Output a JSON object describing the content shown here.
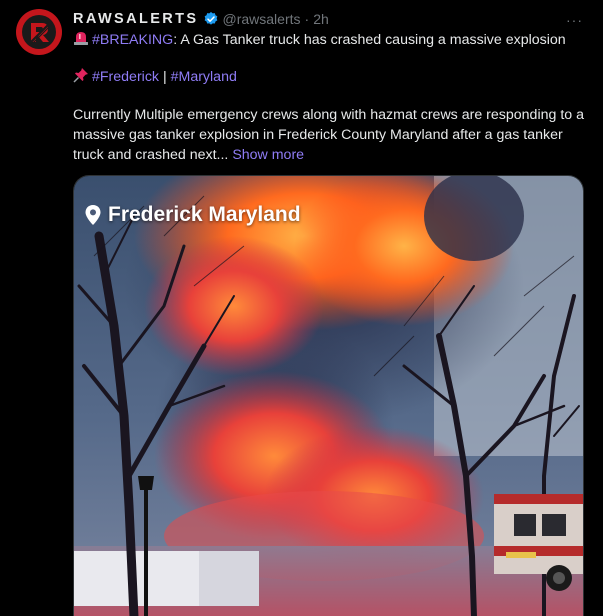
{
  "author": {
    "display_name": "RAWSALERTS",
    "handle": "@rawsalerts",
    "separator": "·",
    "time": "2h",
    "verified_icon": "verified-badge-icon",
    "avatar_icon": "rawsalerts-logo"
  },
  "menu": {
    "more_label": "···"
  },
  "tweet": {
    "line1_tag": "#BREAKING",
    "line1_text": ": A Gas Tanker truck has crashed causing a massive explosion",
    "line1_icon": "rotating-light-icon",
    "line2_icon": "pushpin-icon",
    "tag_frederick": "#Frederick",
    "tag_sep": " | ",
    "tag_maryland": "#Maryland",
    "body": "Currently Multiple emergency crews along with hazmat crews are responding to a massive gas tanker explosion in Frederick County Maryland after a gas tanker truck and crashed next...",
    "show_more": "Show more"
  },
  "media": {
    "location_label": "Frederick Maryland",
    "location_icon": "map-pin-icon"
  },
  "colors": {
    "background": "#000000",
    "text": "#e7e9ea",
    "muted": "#71767b",
    "link": "#8f7cf5",
    "verified": "#1d9bf0",
    "avatar": "#c4161c"
  }
}
